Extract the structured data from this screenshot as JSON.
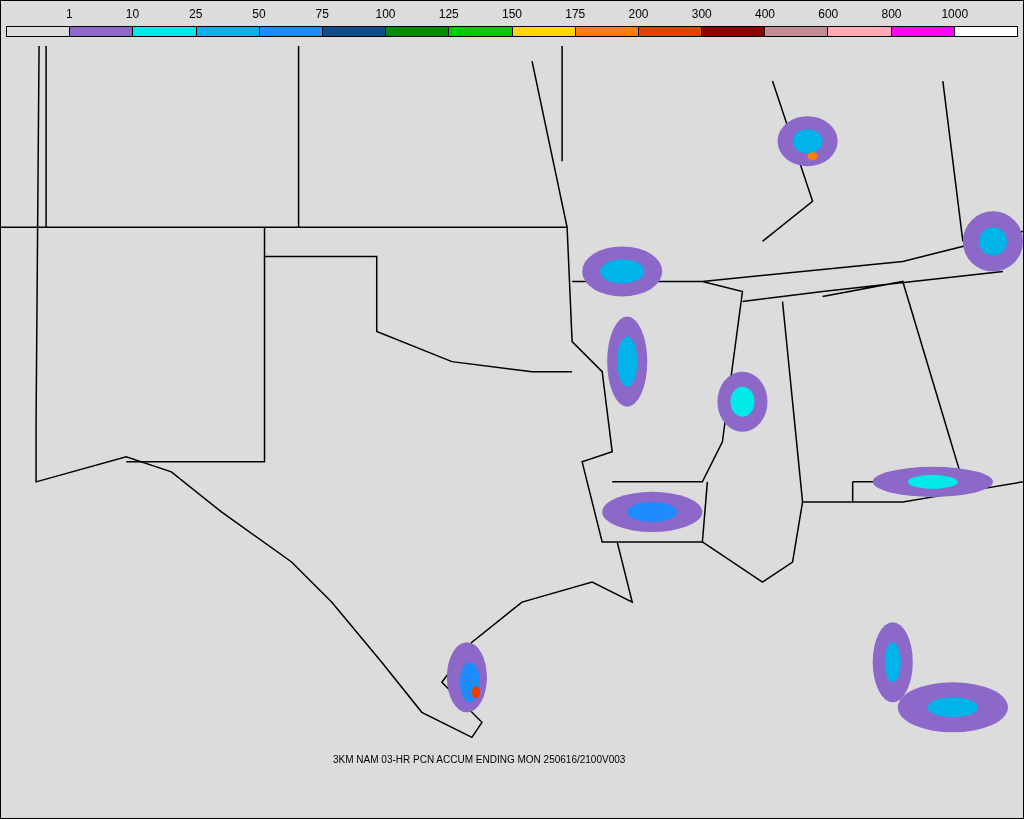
{
  "legend": [
    {
      "color": "#dcdcdc",
      "label": "1"
    },
    {
      "color": "#8c68c8",
      "label": "10"
    },
    {
      "color": "#00eaea",
      "label": "25"
    },
    {
      "color": "#00b4ea",
      "label": "50"
    },
    {
      "color": "#1e8cff",
      "label": "75"
    },
    {
      "color": "#104e8b",
      "label": "100"
    },
    {
      "color": "#008b00",
      "label": "125"
    },
    {
      "color": "#00cd00",
      "label": "150"
    },
    {
      "color": "#ffd700",
      "label": "175"
    },
    {
      "color": "#ff8000",
      "label": "200"
    },
    {
      "color": "#f03c00",
      "label": "300"
    },
    {
      "color": "#8b0000",
      "label": "400"
    },
    {
      "color": "#c48c96",
      "label": "600"
    },
    {
      "color": "#ffaab4",
      "label": "800"
    },
    {
      "color": "#ff00ff",
      "label": "1000"
    },
    {
      "color": "#ffffff"
    }
  ],
  "caption": "3KM NAM 03-HR PCN ACCUM ENDING MON 250616/2100V003"
}
